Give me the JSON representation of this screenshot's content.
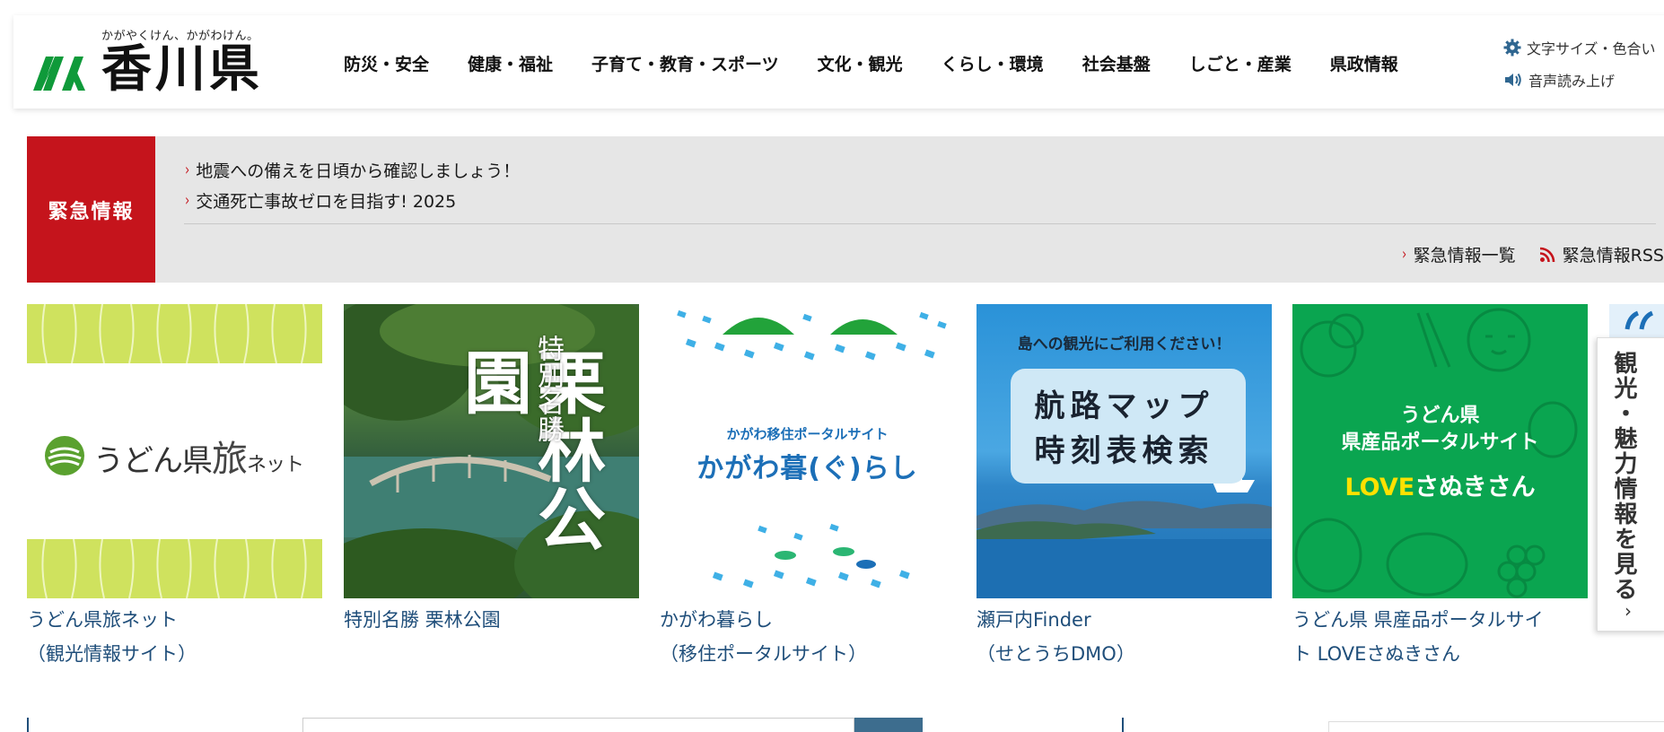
{
  "header": {
    "tagline": "かがやくけん、かがわけん。",
    "logo_text": "香川県",
    "nav": [
      {
        "label": "防災・安全"
      },
      {
        "label": "健康・福祉"
      },
      {
        "label": "子育て・教育・スポーツ"
      },
      {
        "label": "文化・観光"
      },
      {
        "label": "くらし・環境"
      },
      {
        "label": "社会基盤"
      },
      {
        "label": "しごと・産業"
      },
      {
        "label": "県政情報"
      }
    ],
    "utility": {
      "font_color_label": "文字サイズ・色合い",
      "read_aloud_label": "音声読み上げ"
    }
  },
  "emergency": {
    "label": "緊急情報",
    "items": [
      {
        "text": "地震への備えを日頃から確認しましょう！"
      },
      {
        "text": "交通死亡事故ゼロを目指す! 2025"
      }
    ],
    "list_link": "緊急情報一覧",
    "rss_link": "緊急情報RSS"
  },
  "banners": [
    {
      "image_text": "うどん県",
      "image_text2": "旅",
      "image_text3": "ネット",
      "caption_l1": "うどん県旅ネット",
      "caption_l2": "（観光情報サイト）"
    },
    {
      "image_title": "栗林公園",
      "image_sub": "特別名勝",
      "caption_l1": "特別名勝 栗林公園"
    },
    {
      "image_sub": "かがわ移住ポータルサイト",
      "image_title": "かがわ暮(ぐ)らし",
      "caption_l1": "かがわ暮らし",
      "caption_l2": "（移住ポータルサイト）"
    },
    {
      "image_top": "島への観光にご利用ください！",
      "image_l1": "航路マップ",
      "image_l2": "時刻表検索",
      "caption_l1": "瀬戸内Finder",
      "caption_l2": "（せとうちDMO）"
    },
    {
      "image_l1": "うどん県",
      "image_l2": "県産品ポータルサイト",
      "image_l3a": "LOVE",
      "image_l3b": "さぬきさん",
      "caption_l1": "うどん県 県産品ポータルサイ",
      "caption_l2": "ト LOVEさぬきさん"
    }
  ],
  "sidetab": {
    "label": "観光・魅力情報を見る",
    "chevron": "›"
  },
  "colors": {
    "emergency_red": "#c5141c",
    "caption_blue": "#1f4e7a",
    "emergency_bg": "#e6e6e6",
    "logo_green": "#0f9a3a"
  }
}
